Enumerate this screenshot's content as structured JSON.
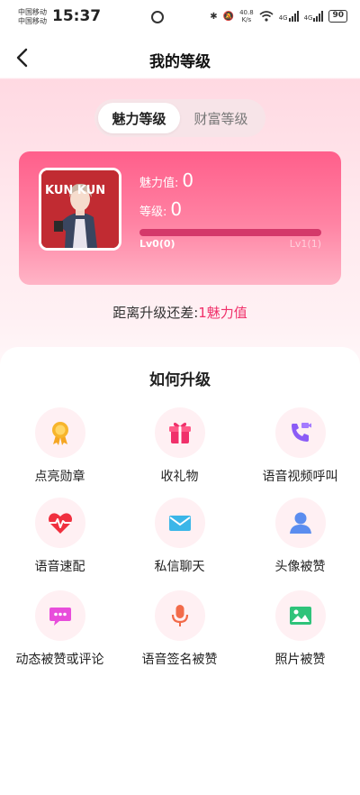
{
  "status_bar": {
    "carrier_1": "中国移动",
    "carrier_2": "中国移动",
    "time": "15:37",
    "net_speed_value": "40.8",
    "net_speed_unit": "K/s",
    "signal_1": "4G",
    "signal_2": "4G",
    "battery": "90"
  },
  "nav": {
    "title": "我的等级"
  },
  "tabs": [
    {
      "label": "魅力等级",
      "active": true
    },
    {
      "label": "财富等级",
      "active": false
    }
  ],
  "card": {
    "avatar_text": "KUN KUN",
    "charm_label": "魅力值:",
    "charm_value": "0",
    "level_label": "等级:",
    "level_value": "0",
    "progress": 0,
    "current_level": "Lv0(0)",
    "next_level": "Lv1(1)"
  },
  "gap": {
    "prefix": "距离升级还差:",
    "value": "1魅力值"
  },
  "how_to": {
    "title": "如何升级",
    "items": [
      {
        "label": "点亮勋章",
        "icon": "medal-icon"
      },
      {
        "label": "收礼物",
        "icon": "gift-icon"
      },
      {
        "label": "语音视频呼叫",
        "icon": "phone-video-icon"
      },
      {
        "label": "语音速配",
        "icon": "heartbeat-icon"
      },
      {
        "label": "私信聊天",
        "icon": "envelope-icon"
      },
      {
        "label": "头像被赞",
        "icon": "user-icon"
      },
      {
        "label": "动态被赞或评论",
        "icon": "chat-bubble-icon"
      },
      {
        "label": "语音签名被赞",
        "icon": "microphone-icon"
      },
      {
        "label": "照片被赞",
        "icon": "image-icon"
      }
    ]
  },
  "colors": {
    "accent": "#f0306a",
    "card_top": "#ff5f8b",
    "card_bottom": "#ffb4c6",
    "icon_bg": "#fff0f3"
  }
}
